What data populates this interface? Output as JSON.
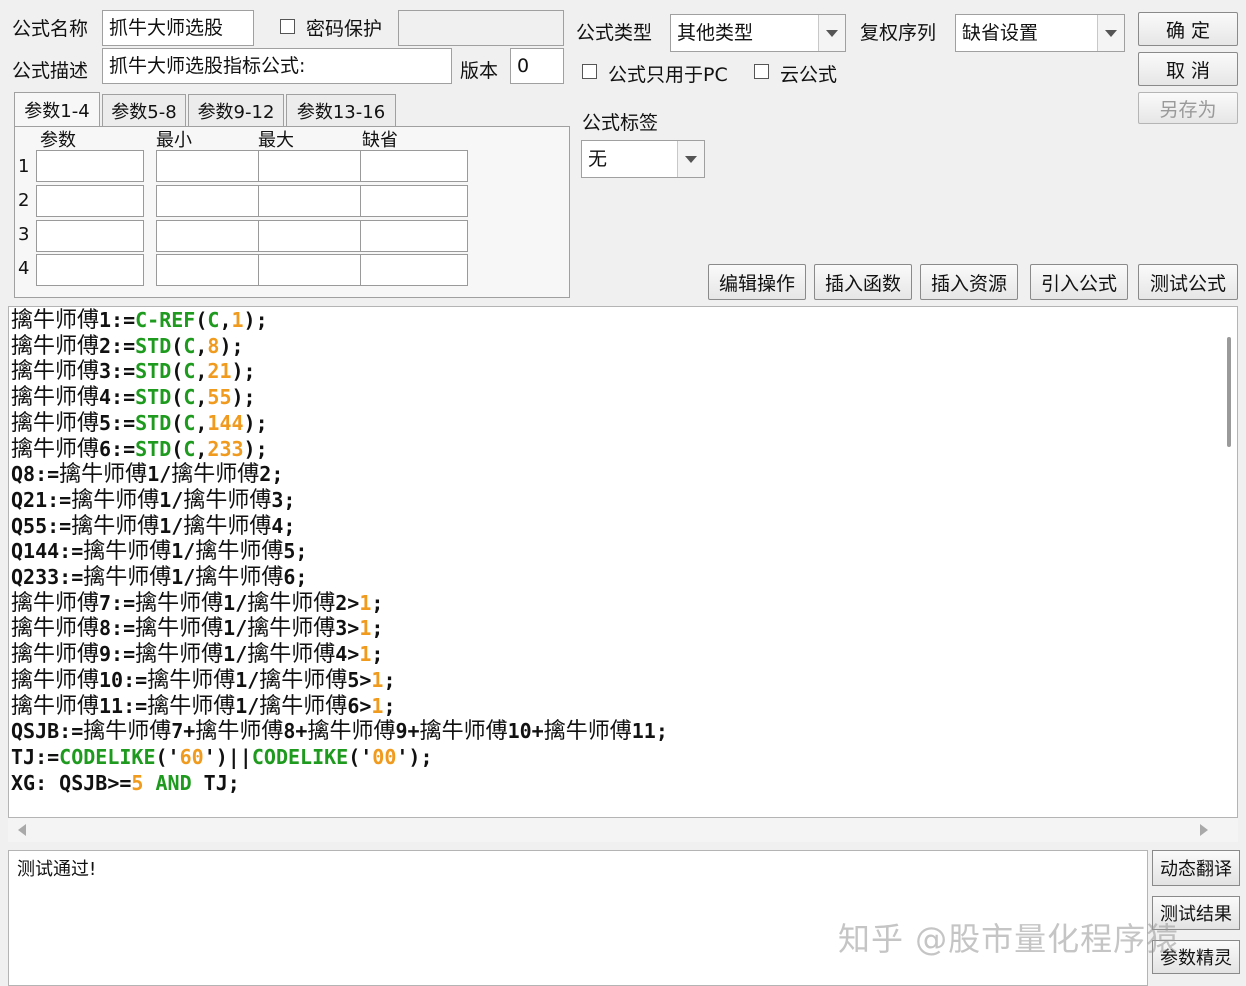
{
  "header": {
    "name_label": "公式名称",
    "name_value": "抓牛大师选股",
    "password_label": "密码保护",
    "desc_label": "公式描述",
    "desc_value": "抓牛大师选股指标公式:",
    "version_label": "版本",
    "version_value": "0",
    "type_label": "公式类型",
    "type_value": "其他类型",
    "rights_label": "复权序列",
    "rights_value": "缺省设置",
    "pc_only_label": "公式只用于PC",
    "cloud_label": "云公式",
    "tag_label": "公式标签",
    "tag_value": "无"
  },
  "buttons": {
    "ok": "确  定",
    "cancel": "取  消",
    "save_as": "另存为",
    "edit_ops": "编辑操作",
    "insert_func": "插入函数",
    "insert_res": "插入资源",
    "import_formula": "引入公式",
    "test_formula": "测试公式"
  },
  "tabs": [
    "参数1-4",
    "参数5-8",
    "参数9-12",
    "参数13-16"
  ],
  "param_table": {
    "headers": [
      "参数",
      "最小",
      "最大",
      "缺省"
    ],
    "rows": [
      "1",
      "2",
      "3",
      "4"
    ]
  },
  "code": [
    [
      [
        "cn",
        "擒牛师傅"
      ],
      [
        "t",
        "1:="
      ],
      [
        "kw",
        "C-REF"
      ],
      [
        "t",
        "("
      ],
      [
        "kw",
        "C"
      ],
      [
        "t",
        ","
      ],
      [
        "num",
        "1"
      ],
      [
        "t",
        ");"
      ]
    ],
    [
      [
        "cn",
        "擒牛师傅"
      ],
      [
        "t",
        "2:="
      ],
      [
        "kw",
        "STD"
      ],
      [
        "t",
        "("
      ],
      [
        "kw",
        "C"
      ],
      [
        "t",
        ","
      ],
      [
        "num",
        "8"
      ],
      [
        "t",
        ");"
      ]
    ],
    [
      [
        "cn",
        "擒牛师傅"
      ],
      [
        "t",
        "3:="
      ],
      [
        "kw",
        "STD"
      ],
      [
        "t",
        "("
      ],
      [
        "kw",
        "C"
      ],
      [
        "t",
        ","
      ],
      [
        "num",
        "21"
      ],
      [
        "t",
        ");"
      ]
    ],
    [
      [
        "cn",
        "擒牛师傅"
      ],
      [
        "t",
        "4:="
      ],
      [
        "kw",
        "STD"
      ],
      [
        "t",
        "("
      ],
      [
        "kw",
        "C"
      ],
      [
        "t",
        ","
      ],
      [
        "num",
        "55"
      ],
      [
        "t",
        ");"
      ]
    ],
    [
      [
        "cn",
        "擒牛师傅"
      ],
      [
        "t",
        "5:="
      ],
      [
        "kw",
        "STD"
      ],
      [
        "t",
        "("
      ],
      [
        "kw",
        "C"
      ],
      [
        "t",
        ","
      ],
      [
        "num",
        "144"
      ],
      [
        "t",
        ");"
      ]
    ],
    [
      [
        "cn",
        "擒牛师傅"
      ],
      [
        "t",
        "6:="
      ],
      [
        "kw",
        "STD"
      ],
      [
        "t",
        "("
      ],
      [
        "kw",
        "C"
      ],
      [
        "t",
        ","
      ],
      [
        "num",
        "233"
      ],
      [
        "t",
        ");"
      ]
    ],
    [
      [
        "t",
        "Q8:="
      ],
      [
        "cn",
        "擒牛师傅"
      ],
      [
        "t",
        "1/"
      ],
      [
        "cn",
        "擒牛师傅"
      ],
      [
        "t",
        "2;"
      ]
    ],
    [
      [
        "t",
        "Q21:="
      ],
      [
        "cn",
        "擒牛师傅"
      ],
      [
        "t",
        "1/"
      ],
      [
        "cn",
        "擒牛师傅"
      ],
      [
        "t",
        "3;"
      ]
    ],
    [
      [
        "t",
        "Q55:="
      ],
      [
        "cn",
        "擒牛师傅"
      ],
      [
        "t",
        "1/"
      ],
      [
        "cn",
        "擒牛师傅"
      ],
      [
        "t",
        "4;"
      ]
    ],
    [
      [
        "t",
        "Q144:="
      ],
      [
        "cn",
        "擒牛师傅"
      ],
      [
        "t",
        "1/"
      ],
      [
        "cn",
        "擒牛师傅"
      ],
      [
        "t",
        "5;"
      ]
    ],
    [
      [
        "t",
        "Q233:="
      ],
      [
        "cn",
        "擒牛师傅"
      ],
      [
        "t",
        "1/"
      ],
      [
        "cn",
        "擒牛师傅"
      ],
      [
        "t",
        "6;"
      ]
    ],
    [
      [
        "cn",
        "擒牛师傅"
      ],
      [
        "t",
        "7:="
      ],
      [
        "cn",
        "擒牛师傅"
      ],
      [
        "t",
        "1/"
      ],
      [
        "cn",
        "擒牛师傅"
      ],
      [
        "t",
        "2>"
      ],
      [
        "num",
        "1"
      ],
      [
        "t",
        ";"
      ]
    ],
    [
      [
        "cn",
        "擒牛师傅"
      ],
      [
        "t",
        "8:="
      ],
      [
        "cn",
        "擒牛师傅"
      ],
      [
        "t",
        "1/"
      ],
      [
        "cn",
        "擒牛师傅"
      ],
      [
        "t",
        "3>"
      ],
      [
        "num",
        "1"
      ],
      [
        "t",
        ";"
      ]
    ],
    [
      [
        "cn",
        "擒牛师傅"
      ],
      [
        "t",
        "9:="
      ],
      [
        "cn",
        "擒牛师傅"
      ],
      [
        "t",
        "1/"
      ],
      [
        "cn",
        "擒牛师傅"
      ],
      [
        "t",
        "4>"
      ],
      [
        "num",
        "1"
      ],
      [
        "t",
        ";"
      ]
    ],
    [
      [
        "cn",
        "擒牛师傅"
      ],
      [
        "t",
        "10:="
      ],
      [
        "cn",
        "擒牛师傅"
      ],
      [
        "t",
        "1/"
      ],
      [
        "cn",
        "擒牛师傅"
      ],
      [
        "t",
        "5>"
      ],
      [
        "num",
        "1"
      ],
      [
        "t",
        ";"
      ]
    ],
    [
      [
        "cn",
        "擒牛师傅"
      ],
      [
        "t",
        "11:="
      ],
      [
        "cn",
        "擒牛师傅"
      ],
      [
        "t",
        "1/"
      ],
      [
        "cn",
        "擒牛师傅"
      ],
      [
        "t",
        "6>"
      ],
      [
        "num",
        "1"
      ],
      [
        "t",
        ";"
      ]
    ],
    [
      [
        "t",
        "QSJB:="
      ],
      [
        "cn",
        "擒牛师傅"
      ],
      [
        "t",
        "7+"
      ],
      [
        "cn",
        "擒牛师傅"
      ],
      [
        "t",
        "8+"
      ],
      [
        "cn",
        "擒牛师傅"
      ],
      [
        "t",
        "9+"
      ],
      [
        "cn",
        "擒牛师傅"
      ],
      [
        "t",
        "10+"
      ],
      [
        "cn",
        "擒牛师傅"
      ],
      [
        "t",
        "11;"
      ]
    ],
    [
      [
        "t",
        "TJ:="
      ],
      [
        "kw",
        "CODELIKE"
      ],
      [
        "t",
        "('"
      ],
      [
        "num",
        "60"
      ],
      [
        "t",
        "')||"
      ],
      [
        "kw",
        "CODELIKE"
      ],
      [
        "t",
        "('"
      ],
      [
        "num",
        "00"
      ],
      [
        "t",
        "');"
      ]
    ],
    [
      [
        "t",
        "XG: QSJB>="
      ],
      [
        "num",
        "5"
      ],
      [
        "t",
        " "
      ],
      [
        "kw",
        "AND"
      ],
      [
        "t",
        " TJ;"
      ]
    ]
  ],
  "output": {
    "text": "测试通过!"
  },
  "side_buttons": {
    "dynamic_translate": "动态翻译",
    "test_result": "测试结果",
    "param_wizard": "参数精灵"
  },
  "watermark": "知乎 @股市量化程序猿",
  "colors": {
    "keyword": "#1e9a1e",
    "number": "#f09a1e",
    "text": "#111111"
  }
}
